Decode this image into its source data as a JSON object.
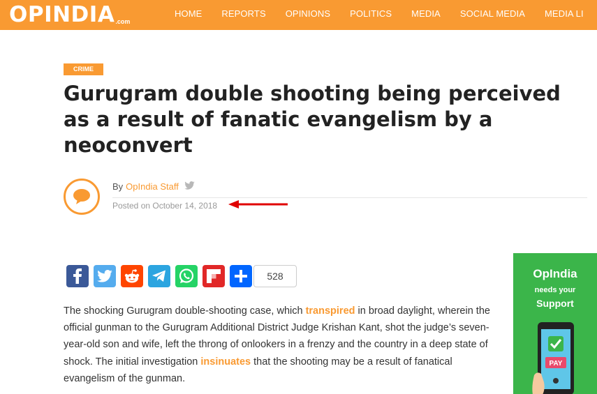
{
  "site": {
    "logo_text": "OPINDIA",
    "logo_suffix": ".com"
  },
  "nav": {
    "items": [
      "HOME",
      "REPORTS",
      "OPINIONS",
      "POLITICS",
      "MEDIA",
      "SOCIAL MEDIA",
      "MEDIA LI"
    ]
  },
  "article": {
    "category": "CRIME",
    "title": "Gurugram double shooting being perceived as a result of fanatic evangelism by a neoconvert",
    "byline_prefix": "By",
    "author": "OpIndia Staff",
    "posted": "Posted on October 14, 2018",
    "body": {
      "p1": "The shocking Gurugram double-shooting case, which ",
      "link1": "transpired",
      "p2": " in broad daylight, wherein the official gunman to the Gurugram Additional District Judge Krishan Kant, shot the judge’s seven-year-old son and wife, left the throng of onlookers in a frenzy and the country in a deep state of shock. The initial investigation ",
      "link2": "insinuates",
      "p3": " that the shooting may be a result of fanatical evangelism of the gunman."
    }
  },
  "share": {
    "buttons": [
      {
        "name": "facebook-icon",
        "color": "#3b5998"
      },
      {
        "name": "twitter-icon",
        "color": "#55acee"
      },
      {
        "name": "reddit-icon",
        "color": "#ff4500"
      },
      {
        "name": "telegram-icon",
        "color": "#2ca5e0"
      },
      {
        "name": "whatsapp-icon",
        "color": "#25d366"
      },
      {
        "name": "flipboard-icon",
        "color": "#e12828"
      },
      {
        "name": "share-plus-icon",
        "color": "#0166ff"
      }
    ],
    "count": "528"
  },
  "ad": {
    "title": "OpIndia",
    "line1": "needs your",
    "line2": "Support",
    "pay_label": "PAY"
  },
  "colors": {
    "brand": "#f99a32",
    "annotation_arrow": "#e00000",
    "ad_bg": "#3bb54a"
  }
}
